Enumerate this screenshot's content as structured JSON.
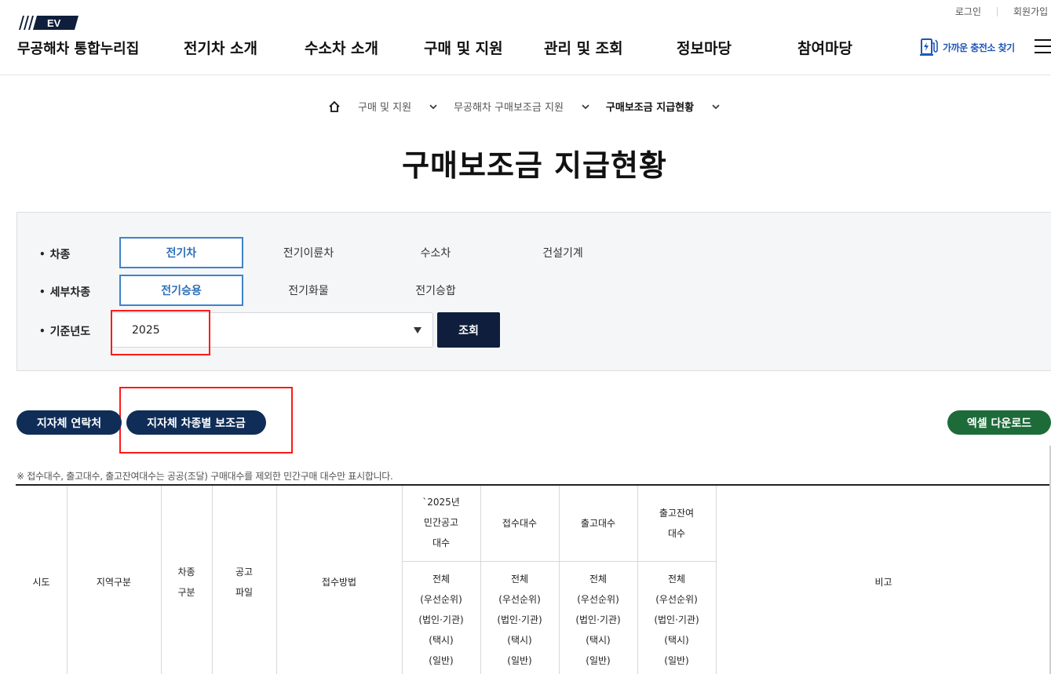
{
  "header": {
    "logo_mark": "EV",
    "site_title": "무공해차 통합누리집",
    "util_links": [
      "로그인",
      "회원가입"
    ],
    "menu": [
      "전기차 소개",
      "수소차 소개",
      "구매 및 지원",
      "관리 및 조회",
      "정보마당",
      "참여마당"
    ],
    "charger_label": "가까운 충전소 찾기"
  },
  "breadcrumb": [
    "구매 및 지원",
    "무공해차 구매보조금 지원",
    "구매보조금 지급현황"
  ],
  "page_title": "구매보조금 지급현황",
  "filters": {
    "vehicle_type": {
      "label": "차종",
      "options": [
        "전기차",
        "전기이륜차",
        "수소차",
        "건설기계"
      ],
      "selected": "전기차"
    },
    "sub_type": {
      "label": "세부차종",
      "options": [
        "전기승용",
        "전기화물",
        "전기승합"
      ],
      "selected": "전기승용"
    },
    "year": {
      "label": "기준년도",
      "value": "2025"
    },
    "search_label": "조회"
  },
  "actions": {
    "contacts": "지자체 연락처",
    "subsidy_by_type": "지자체 차종별 보조금",
    "excel": "엑셀 다운로드"
  },
  "notice": "※ 접수대수, 출고대수, 출고잔여대수는 공공(조달) 구매대수를 제외한 민간구매 대수만 표시합니다.",
  "table": {
    "headers": {
      "sido": "시도",
      "region": "지역구분",
      "vehicle_type": [
        "차종",
        "구분"
      ],
      "notice_file": [
        "공고",
        "파일"
      ],
      "method": "접수방법",
      "notice_count": [
        "`2025년",
        "민간공고",
        "대수"
      ],
      "received": "접수대수",
      "released": "출고대수",
      "remaining": [
        "출고잔여",
        "대수"
      ],
      "remark": "비고"
    },
    "sub_rows": [
      "전체",
      "(우선순위)",
      "(법인·기관)",
      "(택시)",
      "(일반)"
    ]
  },
  "colors": {
    "navy": "#0f2d57",
    "search_button": "#0f1e3c",
    "green": "#1e6b3a",
    "selected_blue": "#3f83c9",
    "annotation_red": "#ff1a1a"
  }
}
